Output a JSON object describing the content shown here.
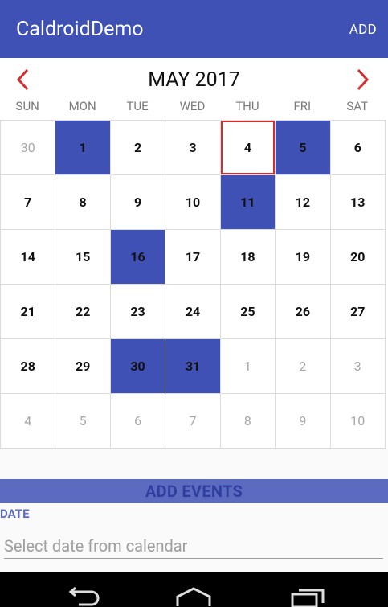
{
  "app_bar": {
    "title": "CaldroidDemo",
    "action_add": "ADD"
  },
  "calendar": {
    "month_title": "MAY 2017",
    "weekdays": [
      "SUN",
      "MON",
      "TUE",
      "WED",
      "THU",
      "FRI",
      "SAT"
    ],
    "today": "4",
    "weeks": [
      [
        "30",
        "1",
        "2",
        "3",
        "4",
        "5",
        "6"
      ],
      [
        "7",
        "8",
        "9",
        "10",
        "11",
        "12",
        "13"
      ],
      [
        "14",
        "15",
        "16",
        "17",
        "18",
        "19",
        "20"
      ],
      [
        "21",
        "22",
        "23",
        "24",
        "25",
        "26",
        "27"
      ],
      [
        "28",
        "29",
        "30",
        "31",
        "1",
        "2",
        "3"
      ],
      [
        "4",
        "5",
        "6",
        "7",
        "8",
        "9",
        "10"
      ]
    ],
    "selected_dates": [
      "1",
      "5",
      "11",
      "16",
      "30",
      "31"
    ],
    "colors": {
      "primary": "#3f51b5",
      "today_border": "#d32f2f",
      "arrow": "#d32f2f"
    }
  },
  "events": {
    "header": "ADD EVENTS",
    "date_label": "DATE",
    "date_placeholder": "Select date from calendar"
  },
  "system_nav": {
    "icons": [
      "back-icon",
      "home-icon",
      "recents-icon"
    ]
  }
}
